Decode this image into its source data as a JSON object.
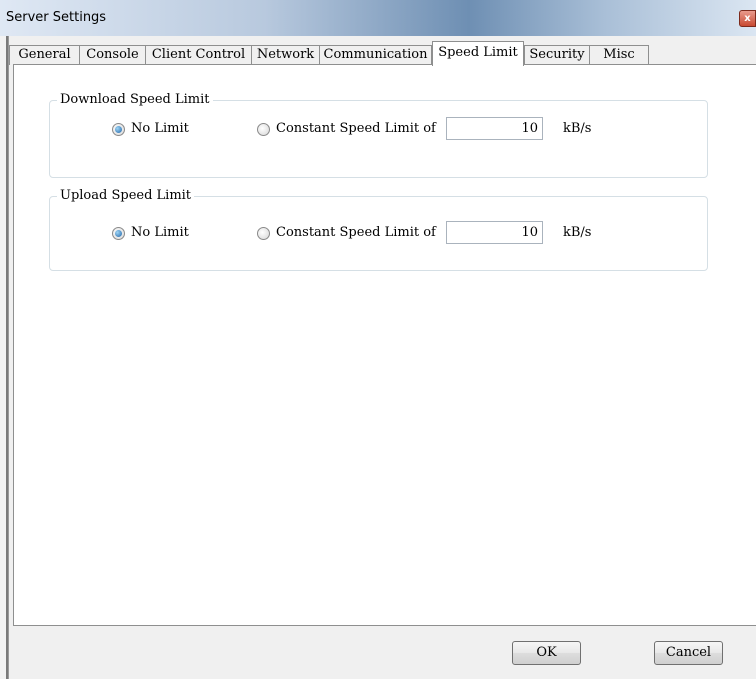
{
  "window": {
    "title": "Server Settings",
    "close_glyph": "x"
  },
  "tabs": [
    {
      "label": "General"
    },
    {
      "label": "Console"
    },
    {
      "label": "Client Control"
    },
    {
      "label": "Network"
    },
    {
      "label": "Communication"
    },
    {
      "label": "Speed Limit",
      "active": true
    },
    {
      "label": "Security"
    },
    {
      "label": "Misc"
    }
  ],
  "download": {
    "title": "Download Speed Limit",
    "option_no_limit": "No Limit",
    "option_constant": "Constant Speed Limit of",
    "selected": "No Limit",
    "value": "10",
    "unit": "kB/s"
  },
  "upload": {
    "title": "Upload Speed Limit",
    "option_no_limit": "No Limit",
    "option_constant": "Constant Speed Limit of",
    "selected": "No Limit",
    "value": "10",
    "unit": "kB/s"
  },
  "buttons": {
    "ok": "OK",
    "cancel": "Cancel"
  },
  "colors": {
    "active_tab": "#ffffff",
    "dialog_bg": "#f0f0f0",
    "radio_dot": "#1f64a8"
  }
}
